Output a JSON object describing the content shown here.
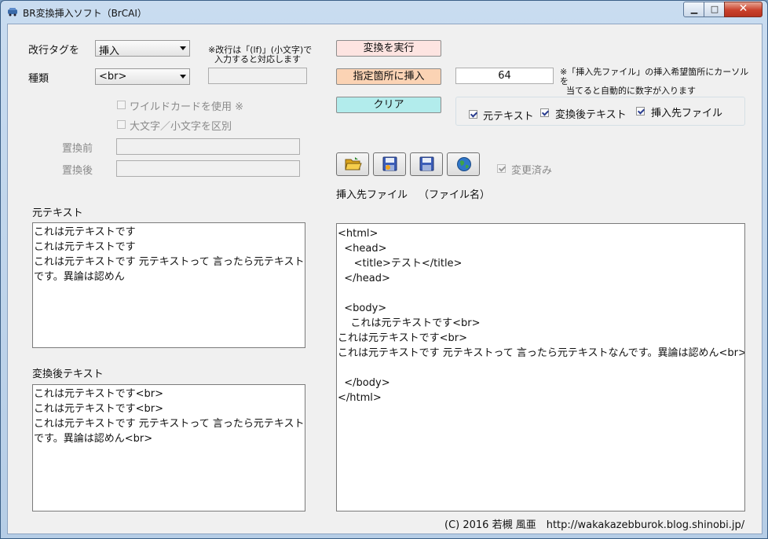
{
  "window": {
    "title": "BR変換挿入ソフト（BrCAI）",
    "min_glyph": "▁",
    "max_glyph": "□",
    "close_glyph": "✕"
  },
  "left": {
    "newline_tag_label": "改行タグを",
    "newline_tag_value": "挿入",
    "kind_label": "種類",
    "kind_value": "<br>",
    "note_lines": [
      "※改行は「(lf)」(小文字)で",
      "入力すると対応します"
    ],
    "wildcard_label": "ワイルドカードを使用 ※",
    "case_label": "大文字／小文字を区別",
    "before_label": "置換前",
    "after_label": "置換後"
  },
  "buttons": {
    "convert": "変換を実行",
    "insert_at": "指定箇所に挿入",
    "clear": "クリア"
  },
  "position_value": "64",
  "position_note": [
    "※「挿入先ファイル」の挿入希望箇所にカーソルを",
    "当てると自動的に数字が入ります"
  ],
  "checks": {
    "original": "元テキスト",
    "converted": "変換後テキスト",
    "target": "挿入先ファイル"
  },
  "modified_label": "変更済み",
  "target_file_label": "挿入先ファイル",
  "file_name_label": "（ファイル名）",
  "original_label": "元テキスト",
  "original_lines": [
    "これは元テキストです",
    "これは元テキストです",
    "これは元テキストです 元テキストって 言ったら元テキストなん",
    "です。異論は認めん"
  ],
  "converted_label": "変換後テキスト",
  "converted_lines": [
    "これは元テキストです<br>",
    "これは元テキストです<br>",
    "これは元テキストです 元テキストって 言ったら元テキストなん",
    "です。異論は認めん<br>"
  ],
  "target_lines": [
    "<html>",
    "  <head>",
    "     <title>テスト</title>",
    "  </head>",
    "",
    "  <body>",
    "    これは元テキストです<br>",
    "これは元テキストです<br>",
    "これは元テキストです 元テキストって 言ったら元テキストなんです。異論は認めん<br>",
    "",
    "  </body>",
    "</html>"
  ],
  "footer": "(C) 2016 若槻 風亜　http://wakakazebburok.blog.shinobi.jp/",
  "icons": {
    "open": "folder-open-icon",
    "save": "save-new-icon",
    "save_as": "save-icon",
    "browser": "globe-icon"
  }
}
